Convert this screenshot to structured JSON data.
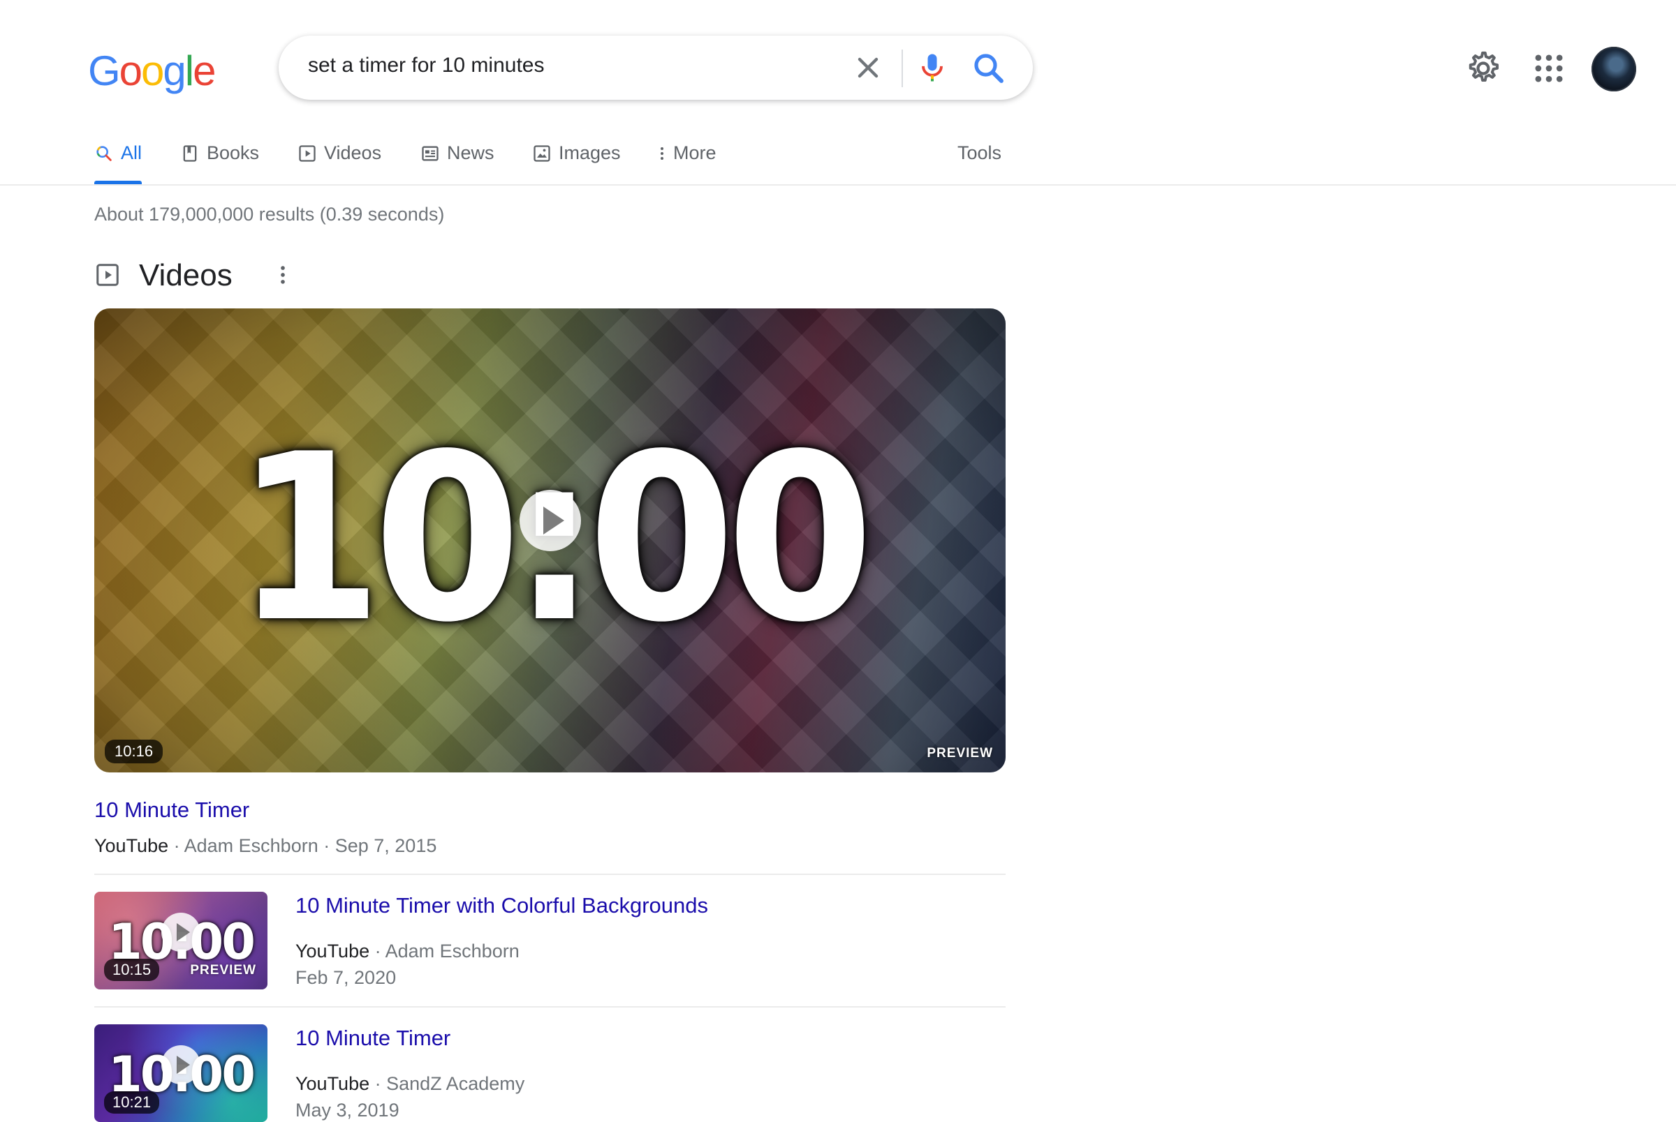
{
  "logo": {
    "letters": [
      "G",
      "o",
      "o",
      "g",
      "l",
      "e"
    ],
    "colors": [
      "#4285F4",
      "#EA4335",
      "#FBBC05",
      "#4285F4",
      "#34A853",
      "#EA4335"
    ]
  },
  "search": {
    "query": "set a timer for 10 minutes"
  },
  "tabs": [
    {
      "label": "All",
      "icon": "search-icon",
      "active": true
    },
    {
      "label": "Books",
      "icon": "book-icon"
    },
    {
      "label": "Videos",
      "icon": "play-icon"
    },
    {
      "label": "News",
      "icon": "newspaper-icon"
    },
    {
      "label": "Images",
      "icon": "image-icon"
    },
    {
      "label": "More",
      "icon": "more-vert-icon"
    }
  ],
  "tools_label": "Tools",
  "stats": "About 179,000,000 results (0.39 seconds)",
  "videos_section": {
    "title": "Videos",
    "main": {
      "thumb_text": "10:00",
      "duration": "10:16",
      "preview": "PREVIEW",
      "title": "10 Minute Timer",
      "source": "YouTube",
      "meta": "· Adam Eschborn · Sep 7, 2015"
    },
    "items": [
      {
        "thumb_text": "10:00",
        "duration": "10:15",
        "preview": "PREVIEW",
        "title": "10 Minute Timer with Colorful Backgrounds",
        "source": "YouTube",
        "channel": "· Adam Eschborn",
        "date": "Feb 7, 2020"
      },
      {
        "thumb_text": "10:00",
        "duration": "10:21",
        "title": "10 Minute Timer",
        "source": "YouTube",
        "channel": "· SandZ Academy",
        "date": "May 3, 2019"
      }
    ]
  },
  "colors": {
    "link": "#1a0dab",
    "accent": "#1a73e8",
    "muted": "#70757a"
  }
}
